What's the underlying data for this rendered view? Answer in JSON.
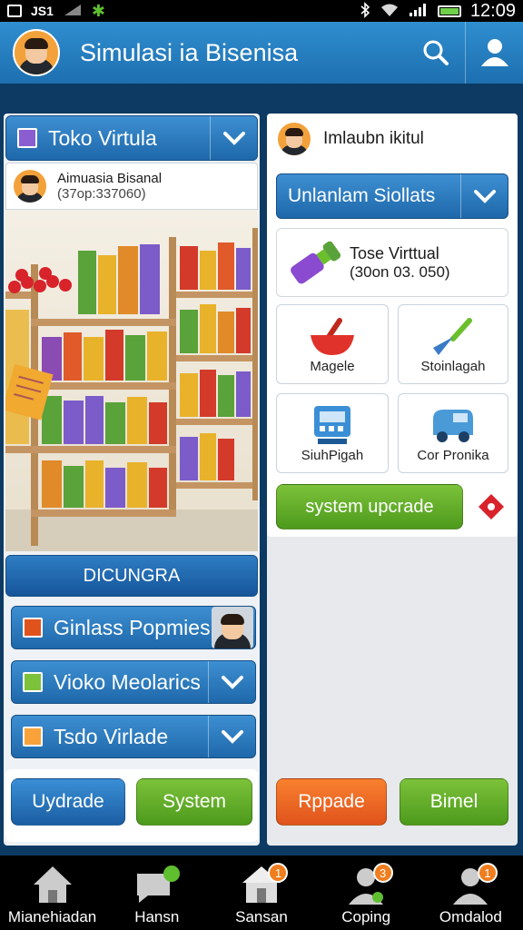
{
  "status_bar": {
    "left_text": "JS1",
    "time": "12:09",
    "icons": [
      "box-icon",
      "signal-icon",
      "gear-icon",
      "bluetooth-icon",
      "wifi-icon",
      "battery-icon"
    ]
  },
  "app_bar": {
    "title": "Simulasi ia Bisenisa",
    "icons": [
      "search-icon",
      "user-icon"
    ]
  },
  "left_panel": {
    "dropdown_label": "Toko Virtula",
    "profile_name": "Aimuasia Bisanal",
    "profile_sub": "(37op:337060)",
    "section_title": "DICUNGRA",
    "rows": [
      {
        "label": "Ginlass Popmies",
        "icon_color": "#e0531c"
      },
      {
        "label": "Vioko Meolarics",
        "icon_color": "#7cc23a"
      },
      {
        "label": "Tsdo Virlade",
        "icon_color": "#f9a23a"
      }
    ],
    "buttons": {
      "left": "Uydrade",
      "right": "System"
    }
  },
  "right_panel": {
    "header_name": "Imlaubn ikitul",
    "dropdown_label": "Unlanlam Siollats",
    "feature_title": "Tose Virttual",
    "feature_sub": "(30on 03. 050)",
    "tiles": [
      {
        "label": "Magele",
        "icon": "bowl-icon"
      },
      {
        "label": "Stoinlagah",
        "icon": "trowel-icon"
      },
      {
        "label": "SiuhPigah",
        "icon": "register-icon"
      },
      {
        "label": "Cor Pronika",
        "icon": "truck-icon"
      }
    ],
    "upgrade_button": "system upcrade",
    "buttons": {
      "left": "Rppade",
      "right": "Bimel"
    }
  },
  "bottom_nav": [
    {
      "label": "Mianehiadan",
      "icon": "home-icon",
      "badge": ""
    },
    {
      "label": "Hansn",
      "icon": "chat-icon",
      "badge": ""
    },
    {
      "label": "Sansan",
      "icon": "store-icon",
      "badge": "1"
    },
    {
      "label": "Coping",
      "icon": "person-icon",
      "badge": "3"
    },
    {
      "label": "Omdalod",
      "icon": "profile-icon",
      "badge": "1"
    }
  ]
}
